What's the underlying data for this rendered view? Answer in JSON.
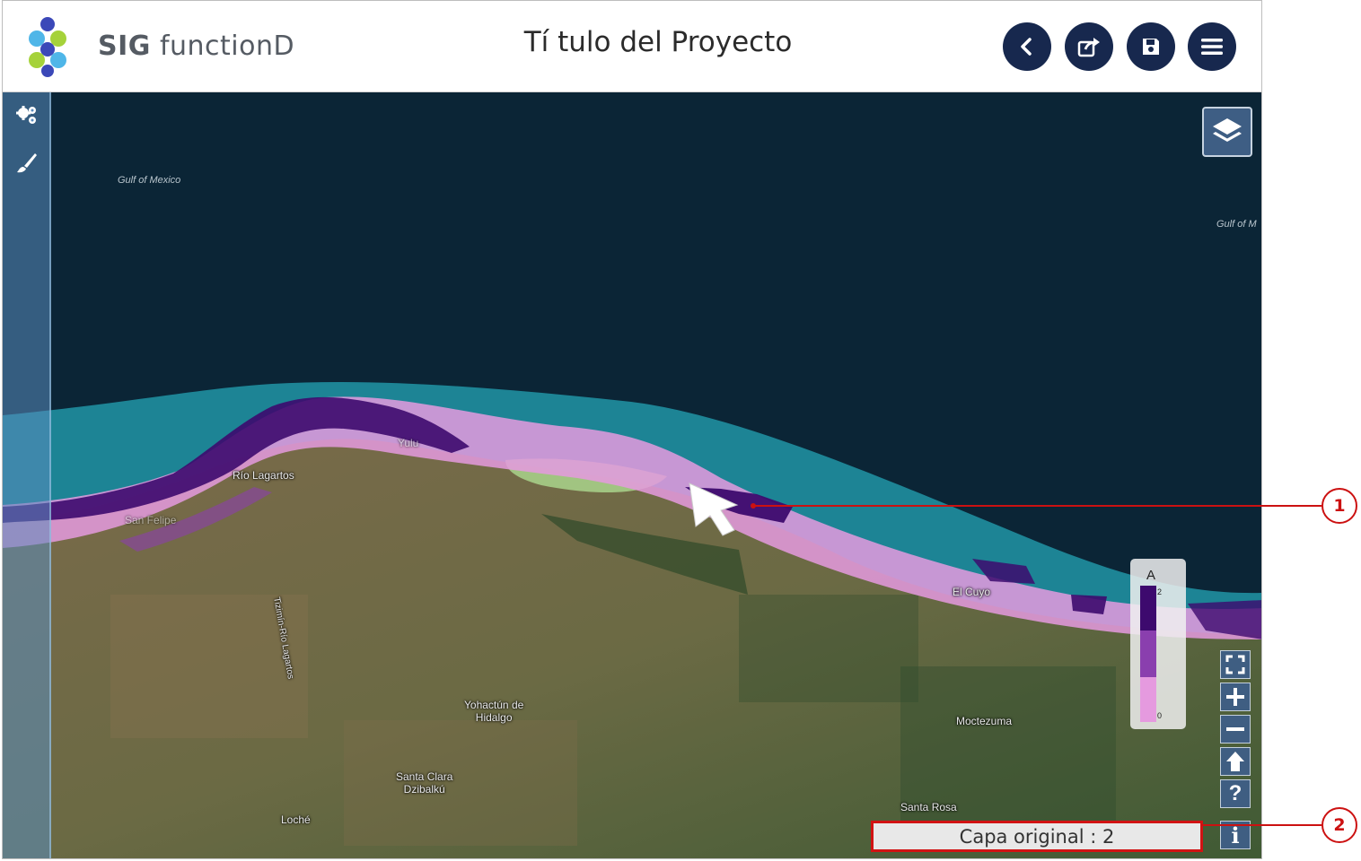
{
  "header": {
    "brand_bold": "SIG",
    "brand_rest": "functionD",
    "title": "Tí tulo del Proyecto",
    "buttons": [
      {
        "icon": "chevron-left-icon"
      },
      {
        "icon": "share-icon"
      },
      {
        "icon": "save-icon"
      },
      {
        "icon": "hamburger-menu-icon"
      }
    ]
  },
  "sidebar": {
    "tools": [
      {
        "icon": "gears-icon"
      },
      {
        "icon": "paintbrush-icon"
      }
    ]
  },
  "map": {
    "labels": {
      "gulf_1": "Gulf of Mexico",
      "gulf_2": "Gulf of M",
      "yulu": "Yulu",
      "rio_lagartos": "Río Lagartos",
      "san_felipe": "San Felipe",
      "tizimin_road": "Tizimín-Río Lagartos",
      "el_cuyo": "El Cuyo",
      "yohactun": "Yohactún de\nHidalgo",
      "moctezuma": "Moctezuma",
      "santa_clara": "Santa Clara\nDzibalkú",
      "loche": "Loché",
      "santa_rosa": "Santa Rosa"
    },
    "legend": {
      "title": "A",
      "max": "2",
      "min": "0",
      "colors": [
        "#3d0a6e",
        "#8a3fae",
        "#e59adf"
      ]
    },
    "zoom_controls": [
      {
        "icon": "fullscreen-icon"
      },
      {
        "icon": "zoom-in-icon"
      },
      {
        "icon": "zoom-out-icon"
      },
      {
        "icon": "home-extent-icon"
      },
      {
        "icon": "help-icon"
      },
      {
        "icon": "info-icon"
      }
    ],
    "status_text": "Capa original : 2"
  },
  "callouts": [
    "1",
    "2"
  ],
  "colors": {
    "header_button": "#17284e",
    "sea": "#0b2536",
    "class_high": "#3d0a6e",
    "class_low": "#e59adf",
    "callout": "#cc1111"
  }
}
